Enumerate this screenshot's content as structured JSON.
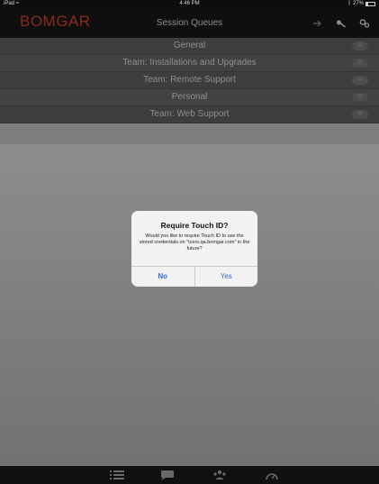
{
  "status_bar": {
    "left": "iPad",
    "time": "4:46 PM",
    "battery": "27%"
  },
  "nav": {
    "logo": "BOMGAR",
    "title": "Session Queues"
  },
  "queues": [
    {
      "name": "General",
      "count": "0"
    },
    {
      "name": "Team: Installations and Upgrades",
      "count": "0"
    },
    {
      "name": "Team: Remote Support",
      "count": "0"
    },
    {
      "name": "Personal",
      "count": "0"
    },
    {
      "name": "Team: Web Support",
      "count": "0"
    }
  ],
  "dialog": {
    "title": "Require Touch ID?",
    "message": "Would you like to require Touch ID to use the stored credentials on \"tcers.qa.bomgar.com\" in the future?",
    "no_label": "No",
    "yes_label": "Yes"
  },
  "tabs": [
    {
      "icon": "list-icon"
    },
    {
      "icon": "chat-icon"
    },
    {
      "icon": "team-icon"
    },
    {
      "icon": "dashboard-icon"
    }
  ],
  "colors": {
    "brand": "#8a2a1f",
    "dialog_button": "#2f6fd6"
  }
}
